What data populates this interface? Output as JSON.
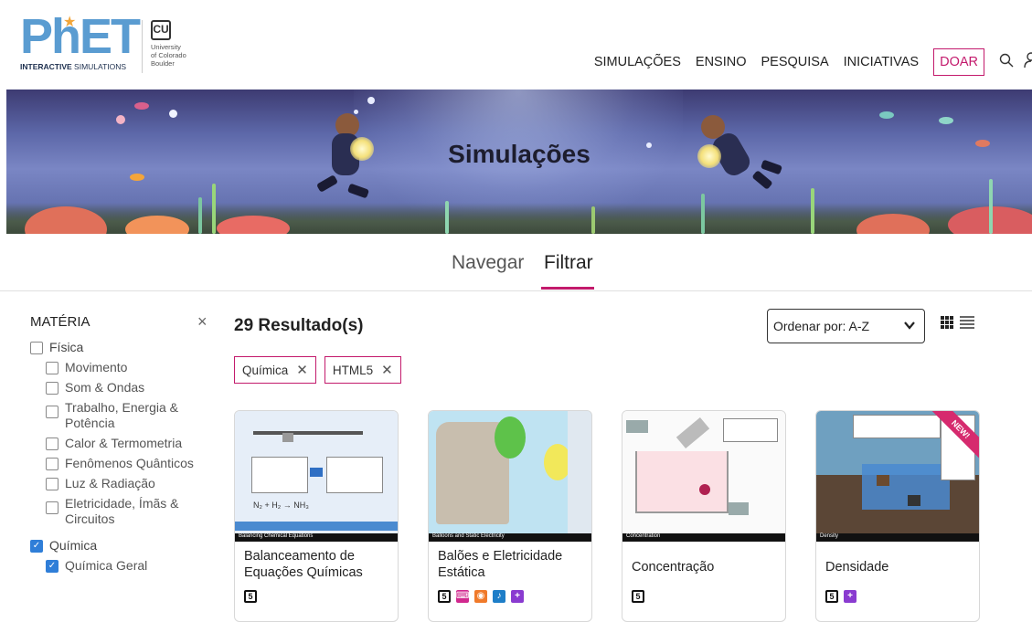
{
  "header": {
    "logo": {
      "wordmark": "PhET",
      "subtitle_bold": "INTERACTIVE",
      "subtitle_rest": "SIMULATIONS"
    },
    "university": {
      "line1": "University",
      "line2": "of Colorado",
      "line3": "Boulder"
    },
    "nav": {
      "simulations": "SIMULAÇÕES",
      "teaching": "ENSINO",
      "research": "PESQUISA",
      "initiatives": "INICIATIVAS",
      "donate": "DOAR"
    },
    "icons": [
      "search-icon",
      "user-icon"
    ]
  },
  "banner": {
    "title": "Simulações"
  },
  "tabs": {
    "browse": "Navegar",
    "filter": "Filtrar",
    "active": "filter"
  },
  "sidebar": {
    "title": "MATÉRIA",
    "items": [
      {
        "label": "Física",
        "checked": false,
        "level": 0
      },
      {
        "label": "Movimento",
        "checked": false,
        "level": 1
      },
      {
        "label": "Som & Ondas",
        "checked": false,
        "level": 1
      },
      {
        "label": "Trabalho, Energia & Potência",
        "checked": false,
        "level": 1
      },
      {
        "label": "Calor & Termometria",
        "checked": false,
        "level": 1
      },
      {
        "label": "Fenômenos Quânticos",
        "checked": false,
        "level": 1
      },
      {
        "label": "Luz & Radiação",
        "checked": false,
        "level": 1
      },
      {
        "label": "Eletricidade, Ímãs & Circuitos",
        "checked": false,
        "level": 1
      },
      {
        "label": "Química",
        "checked": true,
        "level": 0
      },
      {
        "label": "Química Geral",
        "checked": true,
        "level": 1
      }
    ]
  },
  "results": {
    "count_label": "29 Resultado(s)",
    "sort": {
      "selected": "Ordenar por: A-Z"
    },
    "view_modes": [
      "grid-view-icon",
      "list-view-icon"
    ],
    "active_filters": [
      "Química",
      "HTML5"
    ]
  },
  "cards": [
    {
      "title": "Balanceamento de Equações Químicas",
      "thumb_caption": "Balancing Chemical Equations",
      "formats": [
        "html5"
      ],
      "new": false
    },
    {
      "title": "Balões e Eletricidade Estática",
      "thumb_caption": "Balloons and Static Electricity",
      "formats": [
        "html5",
        "keyboard",
        "voicing",
        "sound",
        "zoom"
      ],
      "new": false
    },
    {
      "title": "Concentração",
      "thumb_caption": "Concentration",
      "formats": [
        "html5"
      ],
      "new": false
    },
    {
      "title": "Densidade",
      "thumb_caption": "Density",
      "formats": [
        "html5",
        "zoom"
      ],
      "new": true,
      "new_label": "NEW!"
    }
  ],
  "colors": {
    "accent": "#c31a6c",
    "logo_blue": "#5a9cd1",
    "logo_star": "#f2a63a",
    "check_blue": "#2f7ed8"
  }
}
